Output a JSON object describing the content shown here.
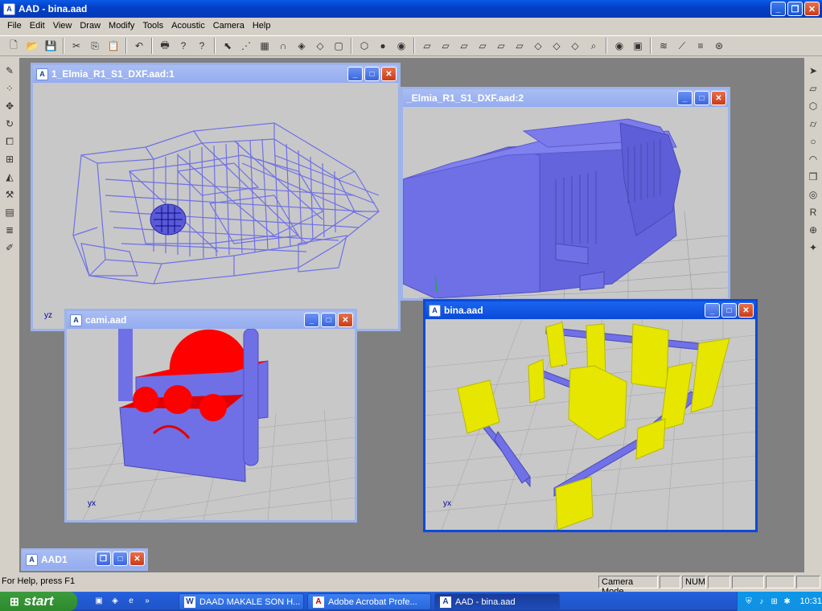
{
  "window": {
    "title": "AAD - bina.aad",
    "minimize": "_",
    "maximize": "❐",
    "close": "✕",
    "app_icon_letter": "A"
  },
  "menu": [
    "File",
    "Edit",
    "View",
    "Draw",
    "Modify",
    "Tools",
    "Acoustic",
    "Camera",
    "Help"
  ],
  "toolbar": {
    "groups": [
      [
        "new-icon",
        "open-icon",
        "save-icon"
      ],
      [
        "cut-icon",
        "copy-icon",
        "paste-icon"
      ],
      [
        "undo-icon"
      ],
      [
        "print-icon",
        "help-icon",
        "context-help-icon"
      ],
      [
        "select-icon",
        "snap-icon",
        "grid-icon",
        "magnet-icon",
        "shade-icon",
        "wireframe-icon",
        "box-icon"
      ],
      [
        "view-iso-icon",
        "render-icon",
        "eye-icon"
      ],
      [
        "view-front-icon",
        "view-back-icon",
        "view-left-icon",
        "view-right-icon",
        "view-top-icon",
        "view-bottom-icon",
        "rotate-x-icon",
        "rotate-y-icon",
        "rotate-z-icon",
        "zoom-icon"
      ],
      [
        "camera-view-icon",
        "render-window-icon"
      ],
      [
        "layers-icon",
        "ray-trace-icon",
        "spectrum-icon",
        "analysis-icon"
      ]
    ],
    "glyphs": {
      "new-icon": "🗋",
      "open-icon": "📂",
      "save-icon": "💾",
      "cut-icon": "✂",
      "copy-icon": "⎘",
      "paste-icon": "📋",
      "undo-icon": "↶",
      "print-icon": "🖶",
      "help-icon": "?",
      "context-help-icon": "?",
      "select-icon": "⬉",
      "snap-icon": "⋰",
      "grid-icon": "▦",
      "magnet-icon": "∩",
      "shade-icon": "◈",
      "wireframe-icon": "◇",
      "box-icon": "▢",
      "view-iso-icon": "⬡",
      "render-icon": "●",
      "eye-icon": "◉",
      "view-front-icon": "▱",
      "view-back-icon": "▱",
      "view-left-icon": "▱",
      "view-right-icon": "▱",
      "view-top-icon": "▱",
      "view-bottom-icon": "▱",
      "rotate-x-icon": "◇",
      "rotate-y-icon": "◇",
      "rotate-z-icon": "◇",
      "zoom-icon": "⌕",
      "camera-view-icon": "◉",
      "render-window-icon": "▣",
      "layers-icon": "≋",
      "ray-trace-icon": "⟋",
      "spectrum-icon": "≡",
      "analysis-icon": "⊛"
    }
  },
  "left_tools": {
    "names": [
      "pencil-icon",
      "points-icon",
      "move-icon",
      "rotate-icon",
      "scale-icon",
      "array-icon",
      "mirror-icon",
      "brush-icon",
      "table-icon",
      "layers-icon",
      "edit-icon"
    ],
    "glyphs": [
      "✎",
      "⁘",
      "✥",
      "↻",
      "⧠",
      "⊞",
      "◭",
      "⚒",
      "▤",
      "≣",
      "✐"
    ]
  },
  "right_tools": {
    "names": [
      "pointer-icon",
      "plane-icon",
      "box-icon",
      "cylinder-icon",
      "circle-icon",
      "dome-icon",
      "cube-icon",
      "target-icon",
      "receiver-icon",
      "source-icon",
      "wand-icon"
    ],
    "glyphs": [
      "➤",
      "▱",
      "⬡",
      "⌭",
      "○",
      "◠",
      "❒",
      "◎",
      "R",
      "⊕",
      "✦"
    ]
  },
  "children": [
    {
      "title": "1_Elmia_R1_S1_DXF.aad:1",
      "axis": "yz"
    },
    {
      "title": "_Elmia_R1_S1_DXF.aad:2"
    },
    {
      "title": "cami.aad",
      "axis": "yx"
    },
    {
      "title": "bina.aad",
      "axis": "yx"
    },
    {
      "title": "AAD1"
    }
  ],
  "child_buttons": {
    "minimize": "_",
    "maximize": "□",
    "restore": "❐",
    "close": "✕"
  },
  "status": {
    "help": "For Help, press F1",
    "mode": "Camera Mode",
    "num": "NUM"
  },
  "taskbar": {
    "start": "start",
    "tasks": [
      {
        "label": "DAAD MAKALE SON H...",
        "icon": "W"
      },
      {
        "label": "Adobe Acrobat Profe...",
        "icon": "A"
      },
      {
        "label": "AAD - bina.aad",
        "icon": "A"
      }
    ],
    "quick_launch_more": "»",
    "clock": "10:31"
  },
  "colors": {
    "model_blue": "#6f70e6",
    "dome_red": "#ff0000",
    "wall_yellow": "#e6e600",
    "titlebar_blue": "#0a4ad8"
  }
}
